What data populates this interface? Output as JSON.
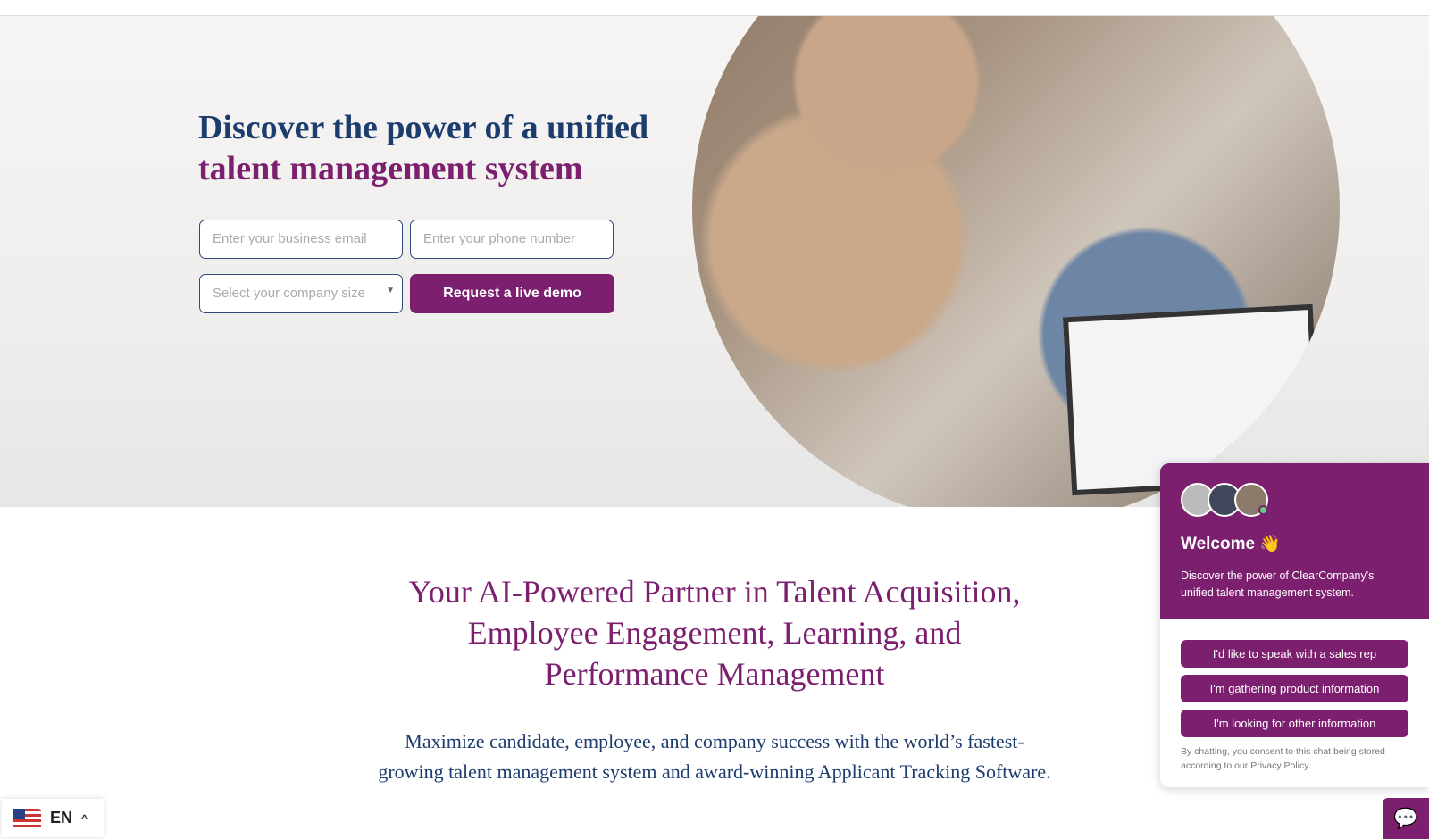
{
  "hero": {
    "title_line1": "Discover the power of a unified",
    "title_line2": "talent management system",
    "email_placeholder": "Enter your business email",
    "phone_placeholder": "Enter your phone number",
    "size_placeholder": "Select your company size",
    "submit_label": "Request a live demo"
  },
  "section": {
    "heading": "Your AI-Powered Partner in Talent Acquisition, Employee Engagement, Learning, and Performance Management",
    "body": "Maximize candidate, employee, and company success with the world’s fastest-growing talent management system and award-winning Applicant Tracking Software."
  },
  "chat": {
    "welcome": "Welcome 👋",
    "intro": "Discover the power of ClearCompany's unified talent management system.",
    "options": [
      "I'd like to speak with a sales rep",
      "I'm gathering product information",
      "I'm looking for other information"
    ],
    "consent": "By chatting, you consent to this chat being stored according to our Privacy Policy."
  },
  "language": {
    "code": "EN"
  },
  "colors": {
    "brand": "#7c1f6f",
    "navy": "#1d3c6e"
  }
}
